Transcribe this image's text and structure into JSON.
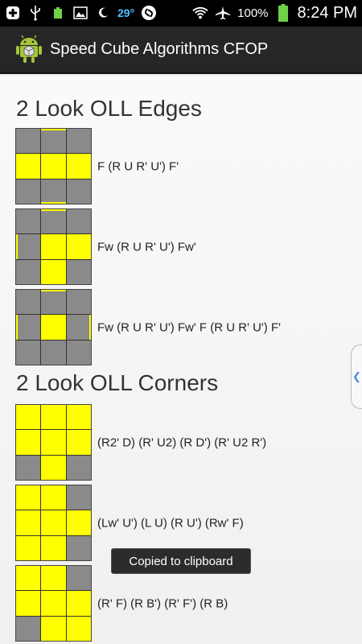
{
  "status_bar": {
    "temperature": "29°",
    "temperature_small": "29°",
    "battery_small": "100%",
    "battery_percent": "100%",
    "time": "8:24 PM",
    "icons": [
      "plus-badge-icon",
      "usb-icon",
      "battery-small-icon",
      "image-icon",
      "moon-icon",
      "shazam-icon",
      "wifi-icon",
      "airplane-icon",
      "battery-icon"
    ]
  },
  "action_bar": {
    "title": "Speed Cube Algorithms CFOP",
    "icon": "android-app-icon"
  },
  "colors": {
    "yellow": "#ffff00",
    "gray": "#8a8a8a",
    "accent": "#4cc3ff"
  },
  "sections": [
    {
      "title": "2 Look OLL Edges",
      "items": [
        {
          "algorithm": "F (R U R' U') F'",
          "grid": [
            "g",
            "g",
            "g",
            "y",
            "y",
            "y",
            "g",
            "g",
            "g"
          ],
          "side_stickers": {
            "1": [
              "top"
            ],
            "7": [
              "bottom"
            ]
          }
        },
        {
          "algorithm": "Fw (R U R' U') Fw'",
          "grid": [
            "g",
            "g",
            "g",
            "g",
            "y",
            "y",
            "g",
            "y",
            "g"
          ],
          "side_stickers": {
            "1": [
              "top"
            ],
            "3": [
              "left"
            ]
          }
        },
        {
          "algorithm": "Fw (R U R' U') Fw' F (R U R' U') F'",
          "grid": [
            "g",
            "g",
            "g",
            "g",
            "y",
            "g",
            "g",
            "g",
            "g"
          ],
          "side_stickers": {
            "1": [
              "top"
            ],
            "3": [
              "left"
            ],
            "5": [
              "right"
            ]
          }
        }
      ]
    },
    {
      "title": "2 Look OLL Corners",
      "items": [
        {
          "algorithm": "(R2' D) (R' U2) (R D') (R' U2 R')",
          "grid": [
            "y",
            "y",
            "y",
            "y",
            "y",
            "y",
            "g",
            "y",
            "g"
          ],
          "side_stickers": {}
        },
        {
          "algorithm": "(Lw' U') (L U) (R U') (Rw' F)",
          "grid": [
            "y",
            "y",
            "g",
            "y",
            "y",
            "y",
            "y",
            "y",
            "g"
          ],
          "side_stickers": {}
        },
        {
          "algorithm": "(R' F) (R B') (R' F') (R B)",
          "grid": [
            "y",
            "y",
            "g",
            "y",
            "y",
            "y",
            "g",
            "y",
            "y"
          ],
          "side_stickers": {}
        }
      ]
    }
  ],
  "toast": {
    "text": "Copied to clipboard"
  }
}
